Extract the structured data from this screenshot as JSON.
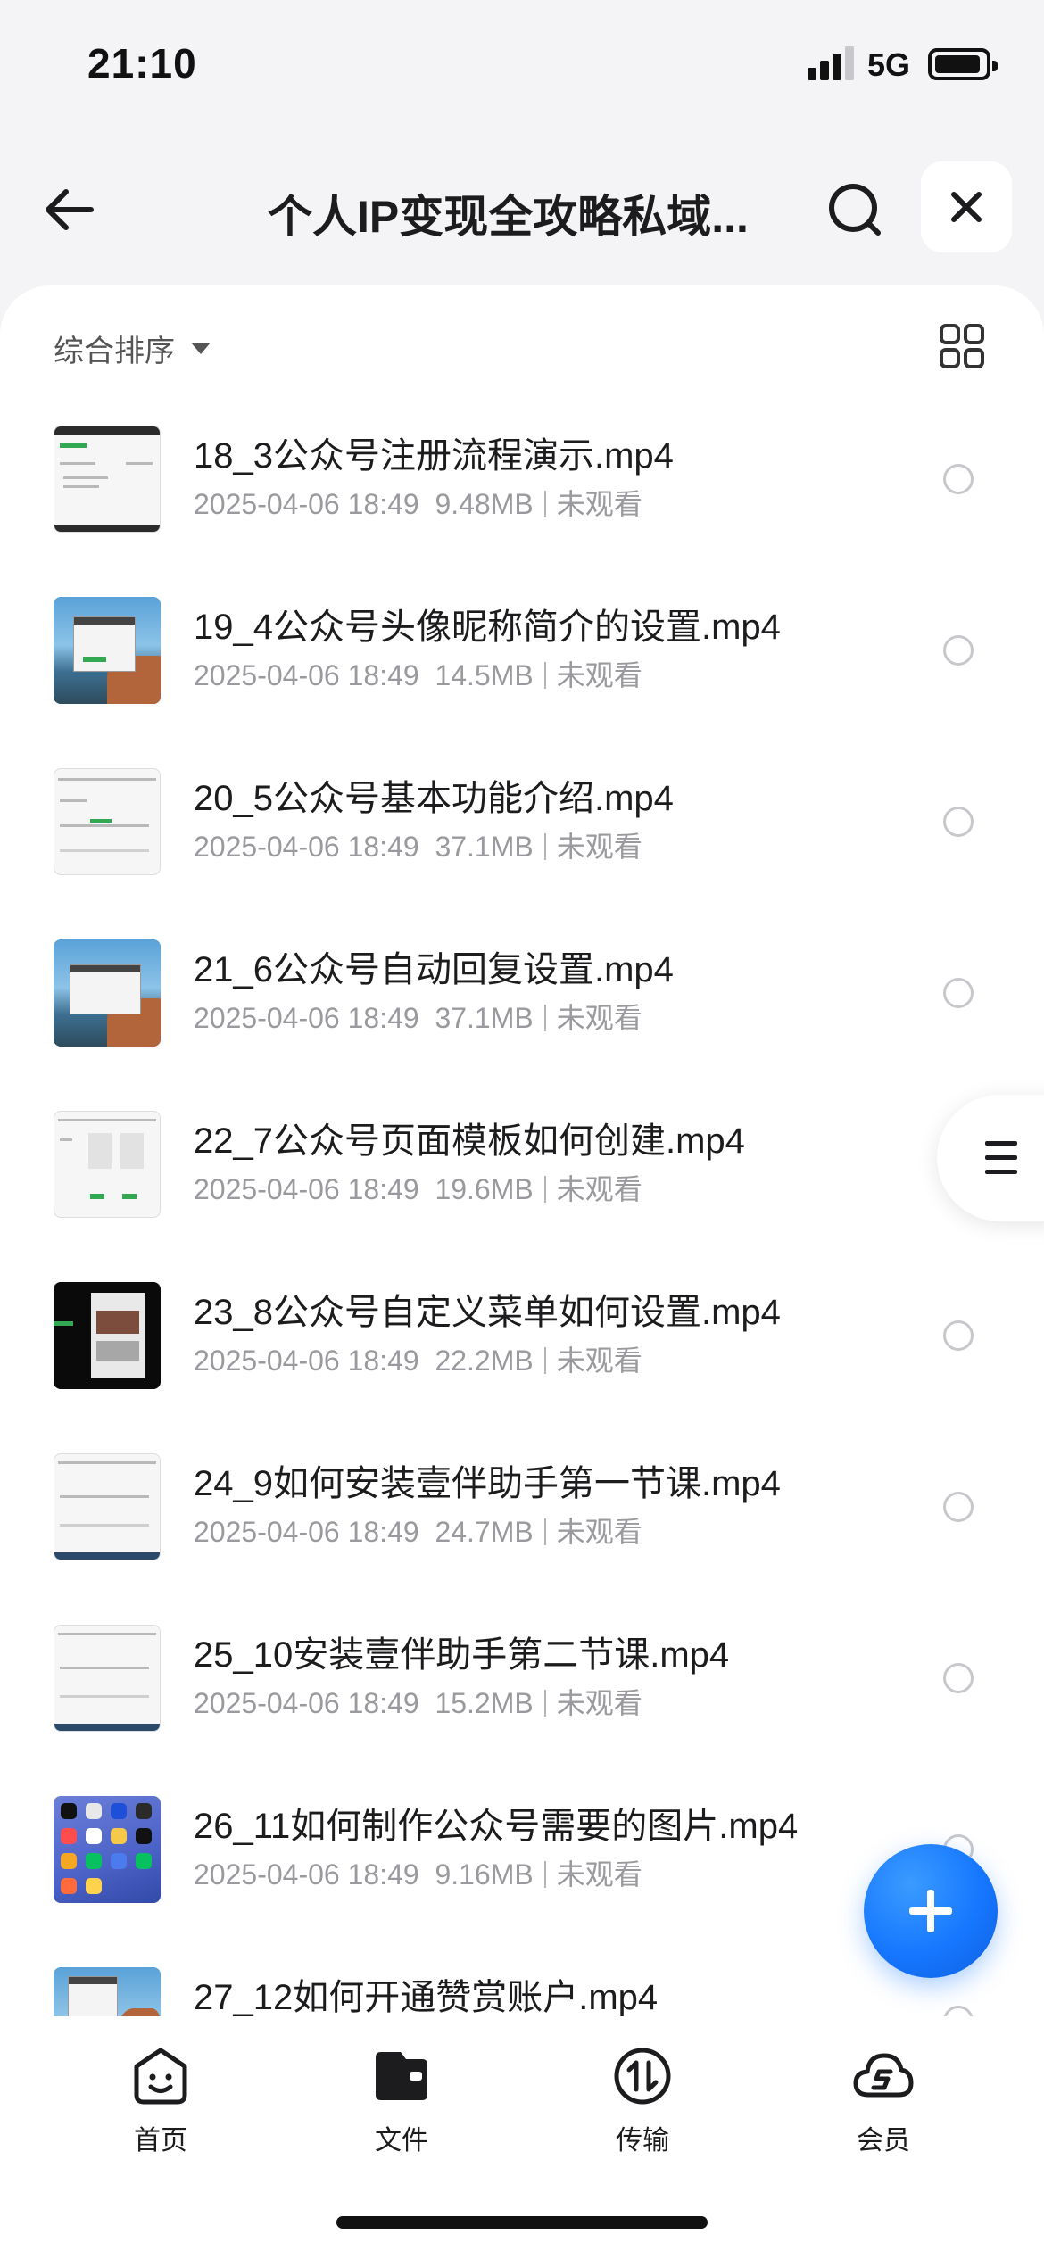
{
  "status_bar": {
    "time": "21:10",
    "network": "5G",
    "icons": [
      "signal-icon",
      "battery-icon"
    ]
  },
  "nav": {
    "title": "个人IP变现全攻略私域...",
    "icons": [
      "back-arrow-icon",
      "search-icon",
      "close-icon"
    ]
  },
  "toolbar": {
    "sort_label": "综合排序",
    "icons": [
      "caret-down-icon",
      "grid-view-icon"
    ]
  },
  "files": [
    {
      "name": "18_3公众号注册流程演示.mp4",
      "date": "2025-04-06 18:49",
      "size": "9.48MB",
      "status": "未观看",
      "thumb": "doc"
    },
    {
      "name": "19_4公众号头像昵称简介的设置.mp4",
      "date": "2025-04-06 18:49",
      "size": "14.5MB",
      "status": "未观看",
      "thumb": "landscape"
    },
    {
      "name": "20_5公众号基本功能介绍.mp4",
      "date": "2025-04-06 18:49",
      "size": "37.1MB",
      "status": "未观看",
      "thumb": "doc"
    },
    {
      "name": "21_6公众号自动回复设置.mp4",
      "date": "2025-04-06 18:49",
      "size": "37.1MB",
      "status": "未观看",
      "thumb": "landscape"
    },
    {
      "name": "22_7公众号页面模板如何创建.mp4",
      "date": "2025-04-06 18:49",
      "size": "19.6MB",
      "status": "未观看",
      "thumb": "doc"
    },
    {
      "name": "23_8公众号自定义菜单如何设置.mp4",
      "date": "2025-04-06 18:49",
      "size": "22.2MB",
      "status": "未观看",
      "thumb": "dark"
    },
    {
      "name": "24_9如何安装壹伴助手第一节课.mp4",
      "date": "2025-04-06 18:49",
      "size": "24.7MB",
      "status": "未观看",
      "thumb": "doc"
    },
    {
      "name": "25_10安装壹伴助手第二节课.mp4",
      "date": "2025-04-06 18:49",
      "size": "15.2MB",
      "status": "未观看",
      "thumb": "doc"
    },
    {
      "name": "26_11如何制作公众号需要的图片.mp4",
      "date": "2025-04-06 18:49",
      "size": "9.16MB",
      "status": "未观看",
      "thumb": "apps"
    },
    {
      "name": "27_12如何开通赞赏账户.mp4",
      "date": "",
      "size": "",
      "status": "",
      "thumb": "landscape"
    }
  ],
  "floating": {
    "side_menu_icon": "menu-icon",
    "fab_icon": "plus-icon",
    "fab_color": "#1677ff"
  },
  "tabs": [
    {
      "label": "首页",
      "icon": "home-smile-icon"
    },
    {
      "label": "文件",
      "icon": "folder-icon"
    },
    {
      "label": "传输",
      "icon": "transfer-icon"
    },
    {
      "label": "会员",
      "icon": "vip-cloud-icon"
    }
  ]
}
